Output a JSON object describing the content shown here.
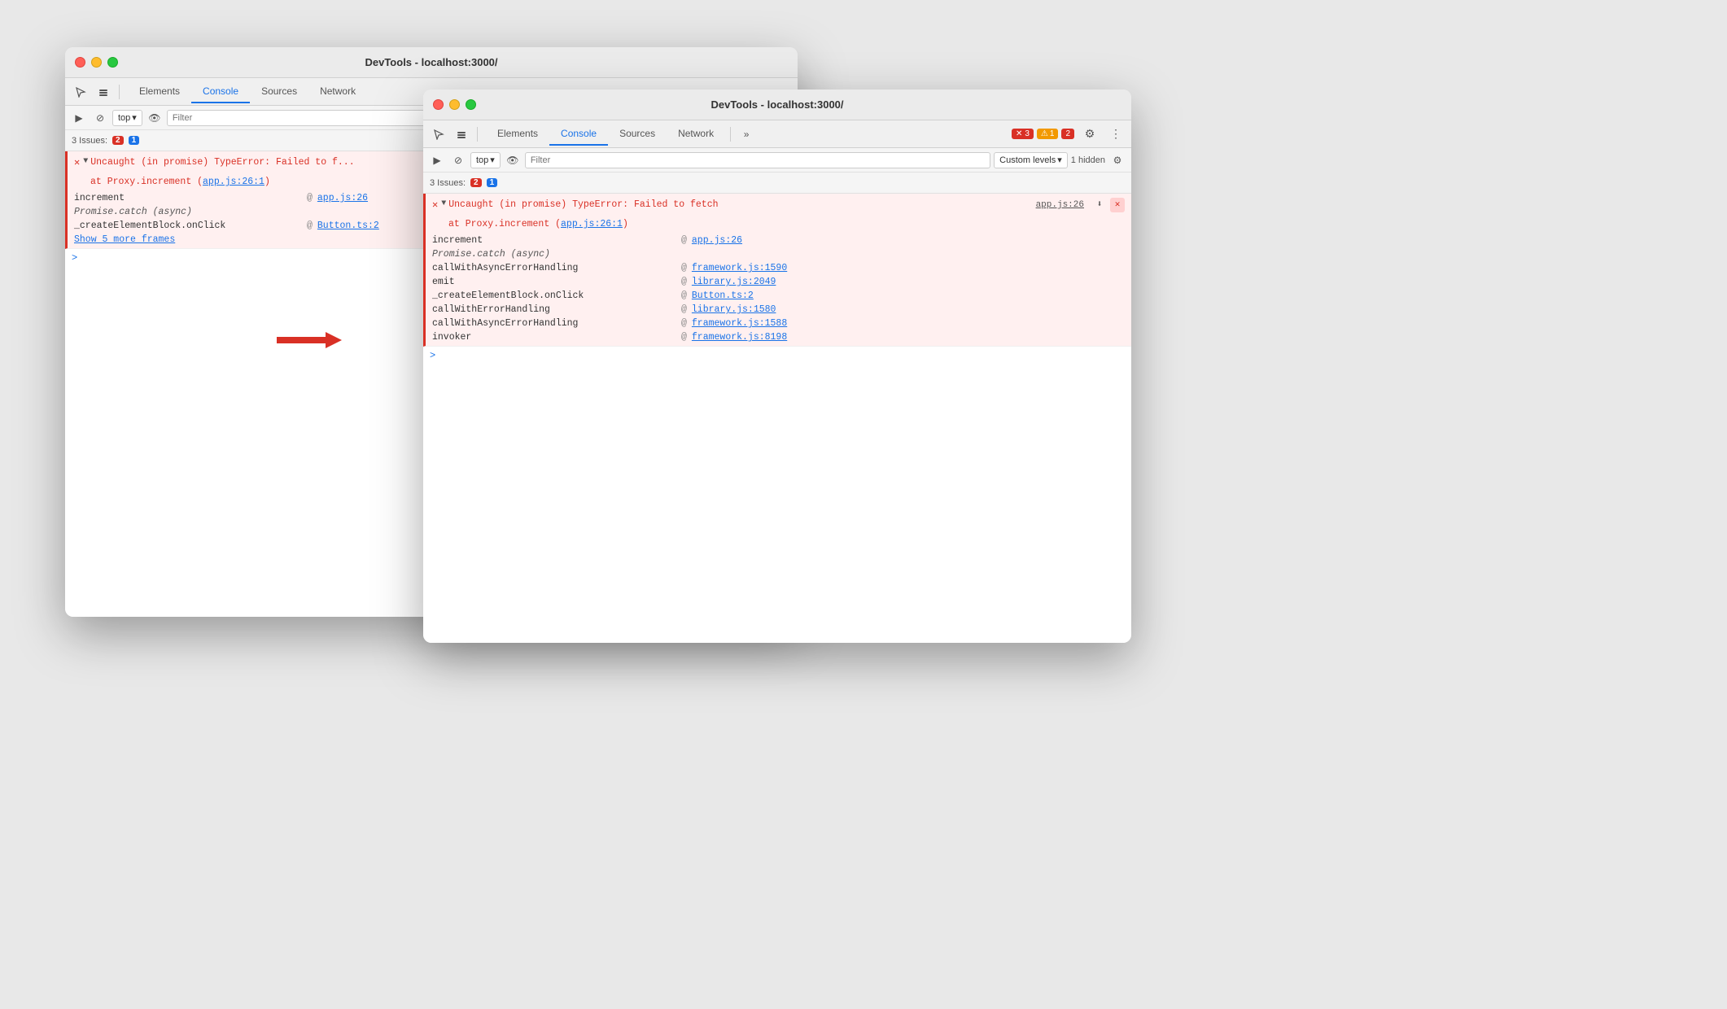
{
  "window1": {
    "title": "DevTools - localhost:3000/",
    "tabs": [
      {
        "label": "Elements",
        "active": false
      },
      {
        "label": "Console",
        "active": true
      },
      {
        "label": "Sources",
        "active": false
      },
      {
        "label": "Network",
        "active": false
      }
    ],
    "console_toolbar": {
      "top_label": "top",
      "filter_placeholder": "Filter"
    },
    "issues_bar": {
      "label": "3 Issues:",
      "error_count": "2",
      "info_count": "1"
    },
    "error_entry": {
      "main_text": "▼ Uncaught (in promise) TypeError: Failed to f...",
      "proxy_text": "at Proxy.increment (app.js:26:1)",
      "link1": "app.js:26",
      "stack": [
        {
          "fn": "increment",
          "at": "@",
          "link": "app.js:26"
        },
        {
          "fn": "Promise.catch (async)",
          "at": "",
          "link": ""
        },
        {
          "fn": "_createElementBlock.onClick",
          "at": "@",
          "link": "Button.ts:2"
        }
      ],
      "show_more": "Show 5 more frames"
    },
    "prompt": ">"
  },
  "window2": {
    "title": "DevTools - localhost:3000/",
    "tabs": [
      {
        "label": "Elements",
        "active": false
      },
      {
        "label": "Console",
        "active": true
      },
      {
        "label": "Sources",
        "active": false
      },
      {
        "label": "Network",
        "active": false
      }
    ],
    "right_badges": {
      "error_icon": "✕",
      "error_count": "3",
      "warning_icon": "⚠",
      "warning_count": "1",
      "error2_count": "2"
    },
    "console_toolbar": {
      "top_label": "top",
      "filter_placeholder": "Filter",
      "custom_levels": "Custom levels",
      "hidden": "1 hidden"
    },
    "issues_bar": {
      "label": "3 Issues:",
      "error_count": "2",
      "info_count": "1"
    },
    "error_entry": {
      "main_line": "▼ Uncaught (in promise) TypeError: Failed to fetch",
      "proxy_line": "  at Proxy.increment (app.js:26:1)",
      "link_ref": "app.js:26",
      "stack": [
        {
          "fn": "increment",
          "at": "@",
          "link": "app.js:26",
          "italic": false
        },
        {
          "fn": "Promise.catch (async)",
          "at": "",
          "link": "",
          "italic": true
        },
        {
          "fn": "callWithAsyncErrorHandling",
          "at": "@",
          "link": "framework.js:1590",
          "italic": false
        },
        {
          "fn": "emit",
          "at": "@",
          "link": "library.js:2049",
          "italic": false
        },
        {
          "fn": "_createElementBlock.onClick",
          "at": "@",
          "link": "Button.ts:2",
          "italic": false
        },
        {
          "fn": "callWithErrorHandling",
          "at": "@",
          "link": "library.js:1580",
          "italic": false
        },
        {
          "fn": "callWithAsyncErrorHandling",
          "at": "@",
          "link": "framework.js:1588",
          "italic": false
        },
        {
          "fn": "invoker",
          "at": "@",
          "link": "framework.js:8198",
          "italic": false
        }
      ]
    },
    "prompt": ">"
  },
  "arrow": {
    "label": "→"
  },
  "icons": {
    "cursor": "⬡",
    "layers": "⬡",
    "play": "▶",
    "ban": "⊘",
    "eye": "👁",
    "chevron_down": "▾",
    "gear": "⚙",
    "more": "⋮",
    "download": "⬇",
    "close_x": "✕",
    "settings": "⚙"
  }
}
